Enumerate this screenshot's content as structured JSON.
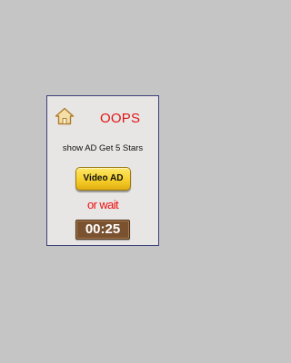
{
  "dialog": {
    "title": "OOPS",
    "message": "show AD Get 5 Stars",
    "video_button_label": "Video AD",
    "or_wait_label": "or wait",
    "timer": "00:25",
    "home_icon": "home-icon"
  },
  "colors": {
    "background": "#c6c5c5",
    "dialog_background": "#e7e6e5",
    "dialog_border": "#3d3f7a",
    "title_red": "#e11414",
    "button_yellow": "#f5cc27",
    "timer_brown": "#7a5230"
  }
}
